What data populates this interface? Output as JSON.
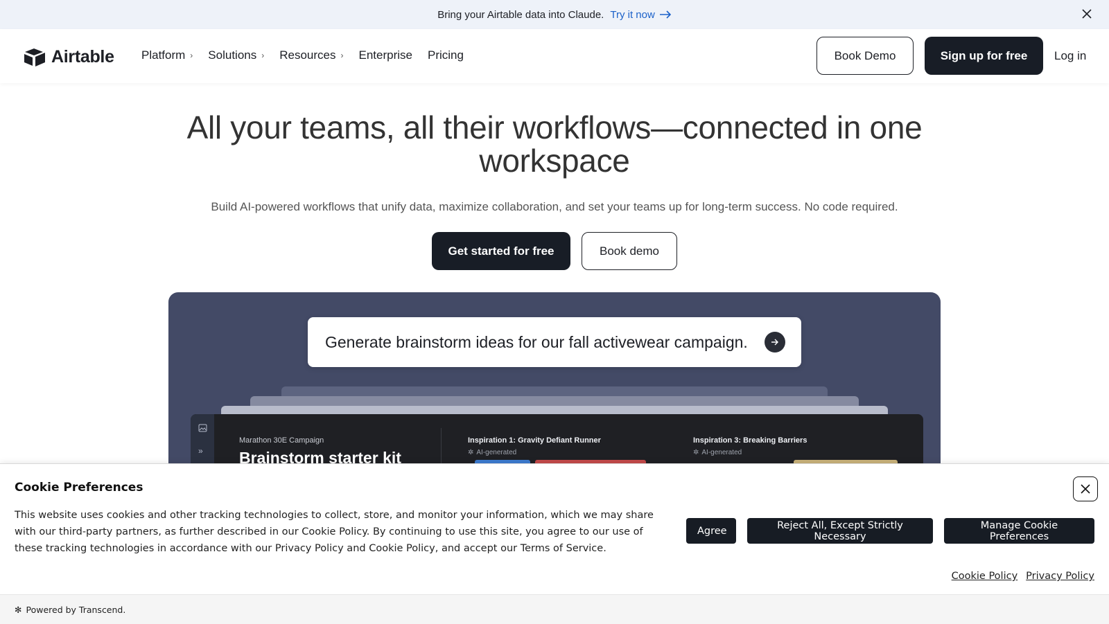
{
  "announcement": {
    "text": "Bring your Airtable data into Claude.",
    "link": "Try it now"
  },
  "brand": {
    "name": "Airtable"
  },
  "nav": {
    "items": [
      {
        "label": "Platform",
        "has_submenu": true
      },
      {
        "label": "Solutions",
        "has_submenu": true
      },
      {
        "label": "Resources",
        "has_submenu": true
      },
      {
        "label": "Enterprise",
        "has_submenu": false
      },
      {
        "label": "Pricing",
        "has_submenu": false
      }
    ],
    "book_demo": "Book Demo",
    "signup": "Sign up for free",
    "login": "Log in"
  },
  "hero": {
    "title": "All your teams, all their workflows—connected in one workspace",
    "subtitle": "Build AI-powered workflows that unify data, maximize collaboration, and set your teams up for long-term success. No code required.",
    "cta_primary": "Get started for free",
    "cta_secondary": "Book demo"
  },
  "demo": {
    "prompt": "Generate brainstorm ideas for our fall activewear campaign.",
    "kicker": "Marathon 30E Campaign",
    "title": "Brainstorm starter kit",
    "inspirations": [
      {
        "title": "Inspiration 1: Gravity Defiant Runner",
        "tag": "AI-generated"
      },
      {
        "title": "Inspiration 3: Breaking Barriers",
        "tag": "AI-generated"
      }
    ]
  },
  "cookie": {
    "title": "Cookie Preferences",
    "body": "This website uses cookies and other tracking technologies to collect, store, and monitor your information, which we may share with our third-party partners, as further described in our Cookie Policy. By continuing to use this site, you agree to our use of these tracking technologies in accordance with our Privacy Policy and Cookie Policy, and accept our Terms of Service.",
    "agree": "Agree",
    "reject": "Reject All, Except Strictly Necessary",
    "manage": "Manage Cookie Preferences",
    "links": [
      "Cookie Policy",
      "Privacy Policy"
    ],
    "powered": "Powered by Transcend."
  },
  "colors": {
    "accent_link": "#1b61c9",
    "dark_button": "#181d26",
    "panel_bg": "#434a66"
  }
}
